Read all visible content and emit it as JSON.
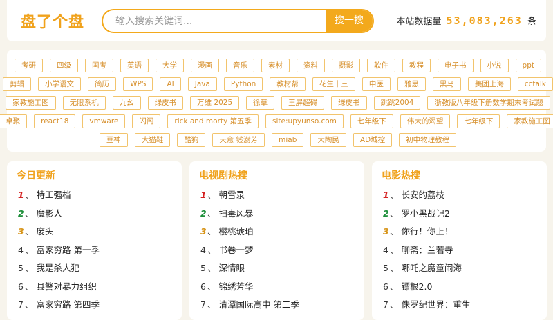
{
  "header": {
    "logo": "盘了个盘",
    "search_placeholder": "输入搜索关键词...",
    "search_button": "搜一搜",
    "stats_prefix": "本站数据量",
    "stats_count": "53,083,263",
    "stats_suffix": "条"
  },
  "colors": {
    "accent": "#f3a91c",
    "rank1": "#d42020",
    "rank2": "#1d8f3a",
    "rank3": "#d79418"
  },
  "tag_rows": [
    [
      "考研",
      "四级",
      "国考",
      "英语",
      "大学",
      "漫画",
      "音乐",
      "素材",
      "资料",
      "摄影",
      "软件",
      "教程",
      "电子书",
      "小说",
      "ppt"
    ],
    [
      "剪辑",
      "小学语文",
      "简历",
      "WPS",
      "AI",
      "Java",
      "Python",
      "教材帮",
      "花生十三",
      "中医",
      "雅思",
      "黑马",
      "美团上海",
      "cctalk"
    ],
    [
      "家教施工图",
      "无限系机",
      "九幺",
      "绿皮书",
      "万维 2025",
      "徐章",
      "王屏超碍",
      "绿皮书",
      "跳跳2004",
      "浙教版八年级下册数学期末考试题"
    ],
    [
      "卓聚",
      "react18",
      "vmware",
      "闪阁",
      "rick and morty 第五季",
      "site:upyunso.com",
      "七年级下",
      "伟大的渴望",
      "七年级下",
      "家教施工图"
    ],
    [
      "豆神",
      "大猫鞋",
      "酷狗",
      "天意 钱澍芳",
      "miab",
      "大陶民",
      "AD城控",
      "初中物理教程"
    ]
  ],
  "panels": [
    {
      "title": "今日更新",
      "items": [
        "特工强档",
        "魔影人",
        "废头",
        "富家穷路 第一季",
        "我是杀人犯",
        "县警对暴力组织",
        "富家穷路 第四季"
      ]
    },
    {
      "title": "电视剧热搜",
      "items": [
        "朝雪录",
        "扫毒风暴",
        "樱桃琥珀",
        "书卷一梦",
        "深情眼",
        "锦绣芳华",
        "清潭国际高中 第二季"
      ]
    },
    {
      "title": "电影热搜",
      "items": [
        "长安的荔枝",
        "罗小黑战记2",
        "你行！你上！",
        "聊斋：兰若寺",
        "哪吒之魔童闹海",
        "镖根2.0",
        "侏罗纪世界：重生"
      ]
    }
  ]
}
